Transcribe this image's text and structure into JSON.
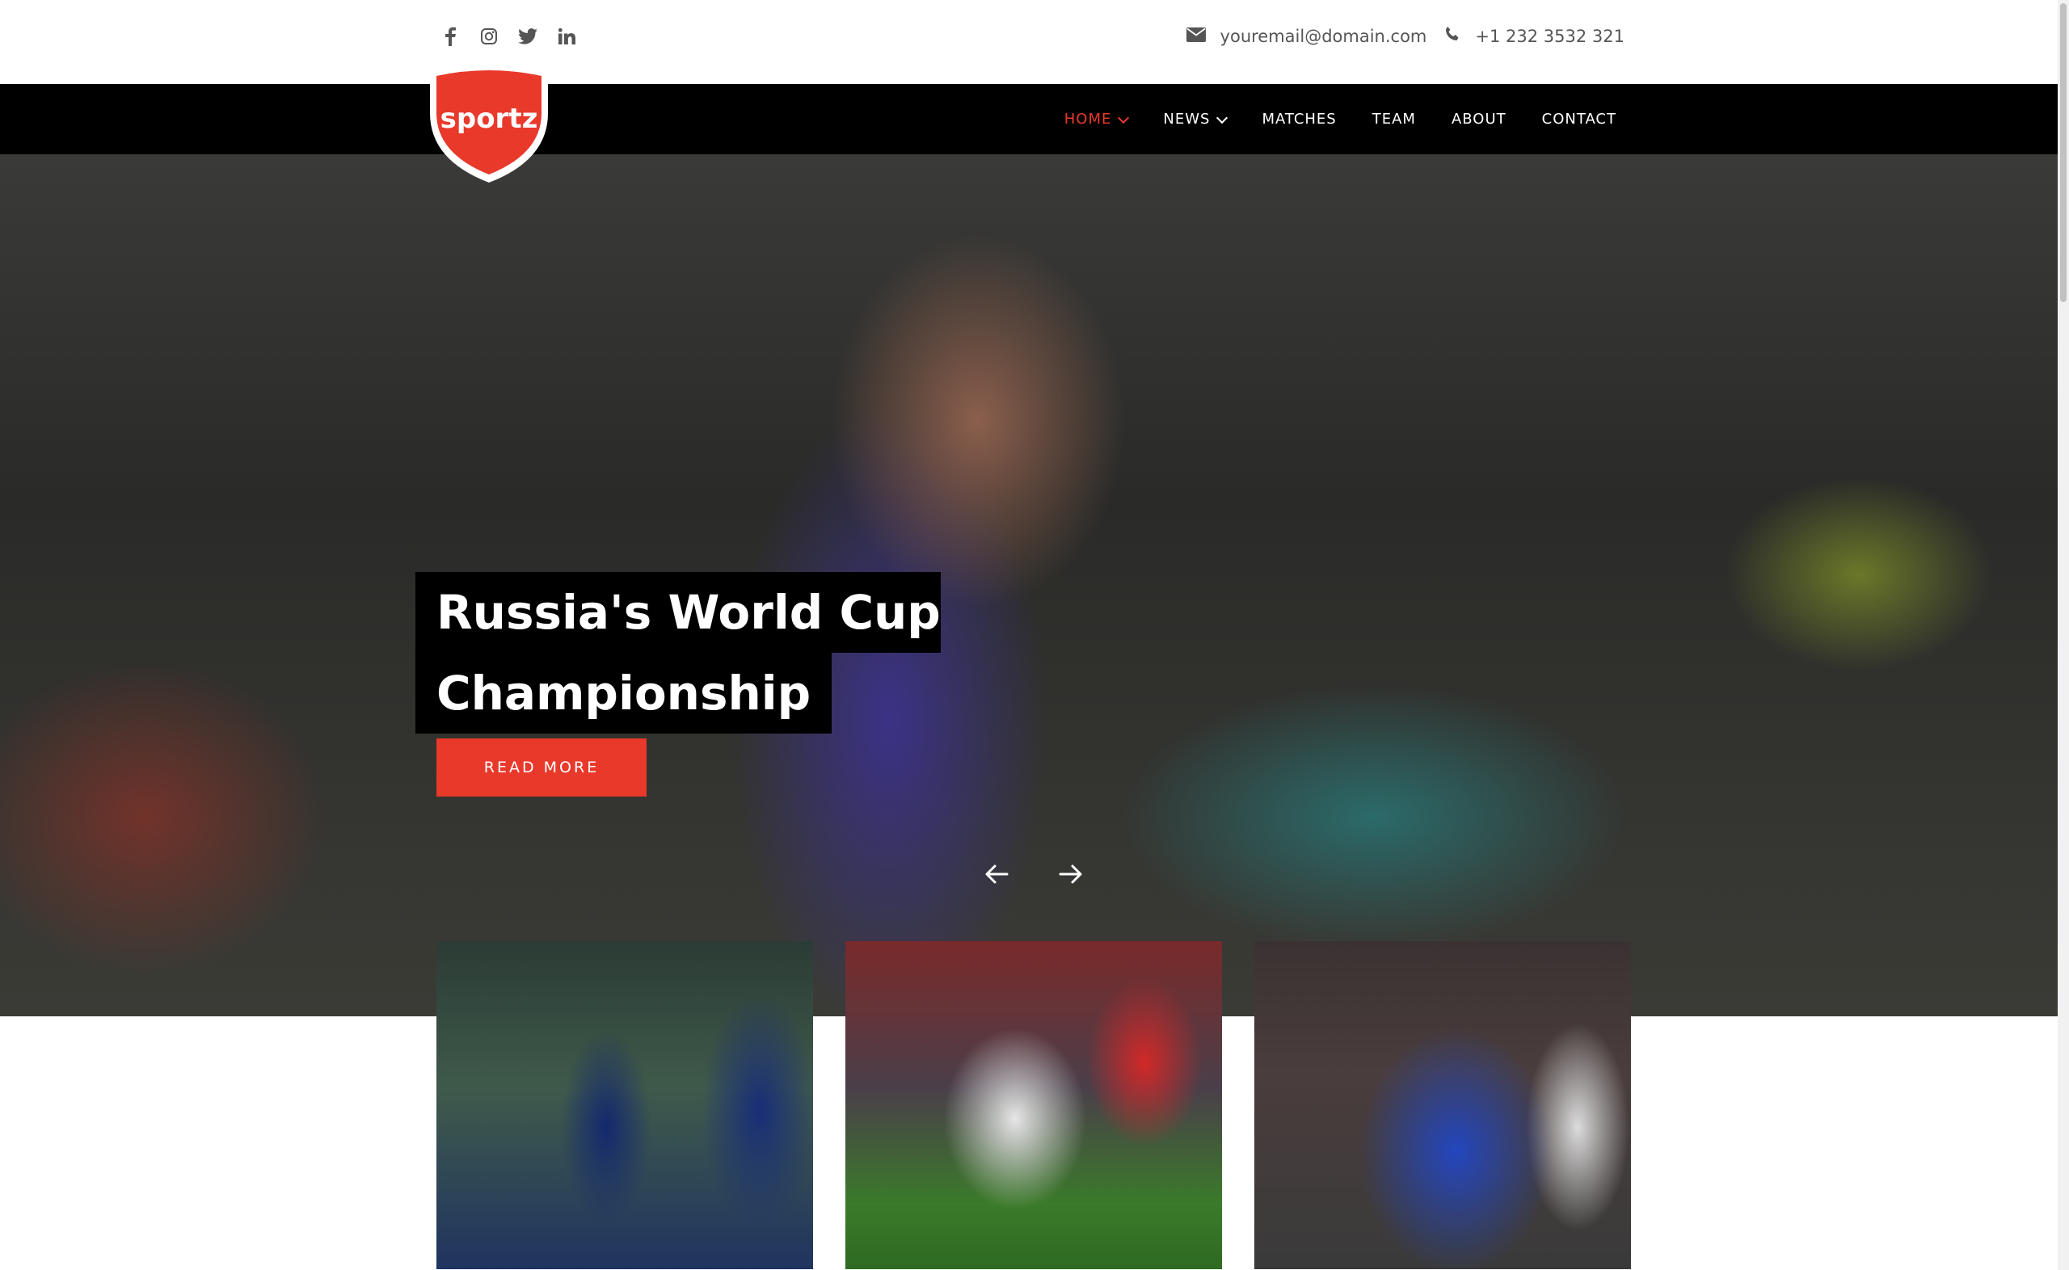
{
  "social": [
    "facebook-icon",
    "instagram-icon",
    "twitter-icon",
    "linkedin-icon"
  ],
  "contact": {
    "email": "youremail@domain.com",
    "phone": "+1 232 3532 321"
  },
  "logo": {
    "text": "sportz",
    "color": "#e8392b"
  },
  "nav": {
    "items": [
      {
        "label": "HOME",
        "active": true,
        "dropdown": true
      },
      {
        "label": "NEWS",
        "active": false,
        "dropdown": true
      },
      {
        "label": "MATCHES",
        "active": false,
        "dropdown": false
      },
      {
        "label": "TEAM",
        "active": false,
        "dropdown": false
      },
      {
        "label": "ABOUT",
        "active": false,
        "dropdown": false
      },
      {
        "label": "CONTACT",
        "active": false,
        "dropdown": false
      }
    ]
  },
  "hero": {
    "title_line1": "Russia's World Cup",
    "title_line2": "Championship",
    "cta": "READ MORE"
  },
  "colors": {
    "accent": "#e8392b",
    "nav_bg": "#000000",
    "text_muted": "#555555"
  }
}
